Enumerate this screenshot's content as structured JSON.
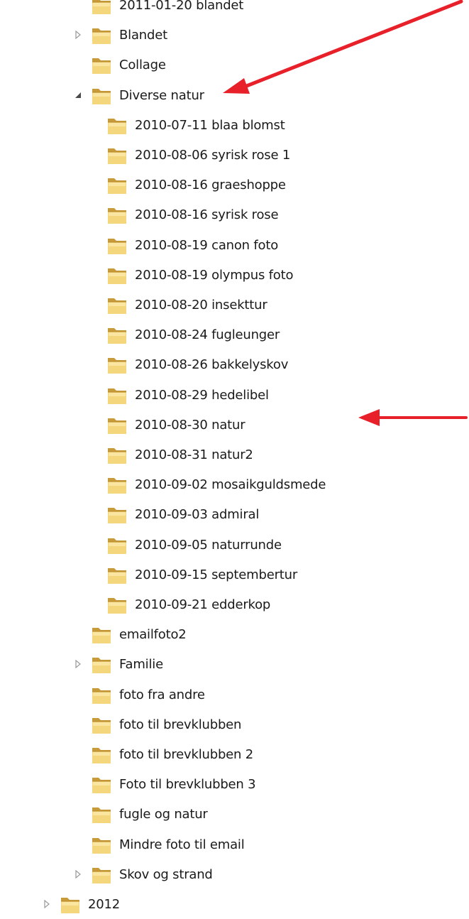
{
  "tree": {
    "items": [
      {
        "label": "2011-01-20 blandet",
        "level": 1,
        "expander": "none"
      },
      {
        "label": "Blandet",
        "level": 1,
        "expander": "collapsed"
      },
      {
        "label": "Collage",
        "level": 1,
        "expander": "none"
      },
      {
        "label": "Diverse natur",
        "level": 1,
        "expander": "expanded"
      },
      {
        "label": "2010-07-11 blaa blomst",
        "level": 2,
        "expander": "none"
      },
      {
        "label": "2010-08-06 syrisk rose 1",
        "level": 2,
        "expander": "none"
      },
      {
        "label": "2010-08-16 graeshoppe",
        "level": 2,
        "expander": "none"
      },
      {
        "label": "2010-08-16 syrisk rose",
        "level": 2,
        "expander": "none"
      },
      {
        "label": "2010-08-19 canon foto",
        "level": 2,
        "expander": "none"
      },
      {
        "label": "2010-08-19 olympus foto",
        "level": 2,
        "expander": "none"
      },
      {
        "label": "2010-08-20 insekttur",
        "level": 2,
        "expander": "none"
      },
      {
        "label": "2010-08-24 fugleunger",
        "level": 2,
        "expander": "none"
      },
      {
        "label": "2010-08-26 bakkelyskov",
        "level": 2,
        "expander": "none"
      },
      {
        "label": "2010-08-29 hedelibel",
        "level": 2,
        "expander": "none"
      },
      {
        "label": "2010-08-30 natur",
        "level": 2,
        "expander": "none"
      },
      {
        "label": "2010-08-31 natur2",
        "level": 2,
        "expander": "none"
      },
      {
        "label": "2010-09-02 mosaikguldsmede",
        "level": 2,
        "expander": "none"
      },
      {
        "label": "2010-09-03 admiral",
        "level": 2,
        "expander": "none"
      },
      {
        "label": "2010-09-05 naturrunde",
        "level": 2,
        "expander": "none"
      },
      {
        "label": "2010-09-15 septembertur",
        "level": 2,
        "expander": "none"
      },
      {
        "label": "2010-09-21 edderkop",
        "level": 2,
        "expander": "none"
      },
      {
        "label": "emailfoto2",
        "level": 1,
        "expander": "none"
      },
      {
        "label": "Familie",
        "level": 1,
        "expander": "collapsed"
      },
      {
        "label": "foto fra andre",
        "level": 1,
        "expander": "none"
      },
      {
        "label": "foto til brevklubben",
        "level": 1,
        "expander": "none"
      },
      {
        "label": "foto til brevklubben 2",
        "level": 1,
        "expander": "none"
      },
      {
        "label": "Foto til brevklubben 3",
        "level": 1,
        "expander": "none"
      },
      {
        "label": "fugle og natur",
        "level": 1,
        "expander": "none"
      },
      {
        "label": "Mindre foto til email",
        "level": 1,
        "expander": "none"
      },
      {
        "label": "Skov og strand",
        "level": 1,
        "expander": "collapsed"
      },
      {
        "label": "2012",
        "level": 0,
        "expander": "collapsed"
      }
    ]
  },
  "colors": {
    "arrow": "#e8202a",
    "folder_back": "#c79a3a",
    "folder_front": "#f4d77c",
    "folder_front_light": "#fbeaa9",
    "expander": "#4a4a4a",
    "expander_collapsed": "#9a9a9a"
  },
  "icons": {
    "folder": "folder-icon",
    "expand": "triangle-expanded-icon",
    "collapse": "triangle-collapsed-icon",
    "annotation": "red-arrow-annotation"
  }
}
